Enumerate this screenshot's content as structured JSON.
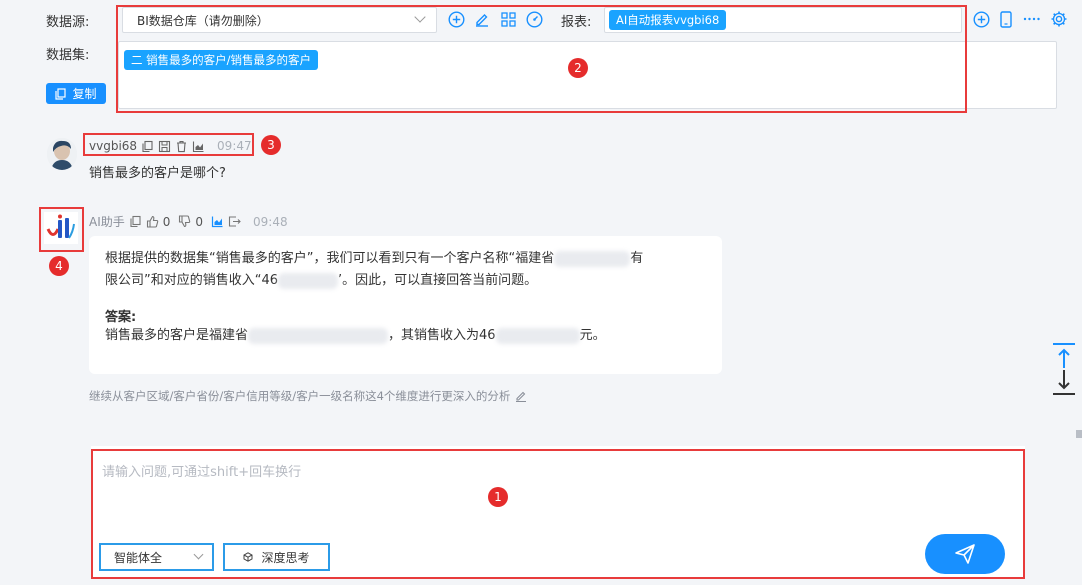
{
  "top": {
    "datasource_label": "数据源:",
    "datasource_value": "BI数据仓库（请勿删除）",
    "report_label": "报表:",
    "report_tag": "AI自动报表vvgbi68",
    "dataset_label": "数据集:",
    "dataset_tag": "二  销售最多的客户/销售最多的客户",
    "copy_label": "复制"
  },
  "user_msg": {
    "name": "vvgbi68",
    "time": "09:47",
    "text": "销售最多的客户是哪个?"
  },
  "ai_msg": {
    "name": "AI助手",
    "like_count": "0",
    "dislike_count": "0",
    "time": "09:48",
    "para1_a": "根据提供的数据集“销售最多的客户”，我们可以看到只有一个客户名称“福建省",
    "para1_b": "有",
    "para1_c": "限公司”和对应的销售收入“46",
    "para1_d": "’。因此，可以直接回答当前问题。",
    "answer_label": "答案:",
    "answer_a": "销售最多的客户是福建省",
    "answer_b": "，其销售收入为46",
    "answer_c": "元。"
  },
  "suggestion": "继续从客户区域/客户省份/客户信用等级/客户一级名称这4个维度进行更深入的分析",
  "input": {
    "placeholder": "请输入问题,可通过shift+回车换行",
    "agent_select": "智能体全",
    "deep_think": "深度思考"
  },
  "badges": [
    "1",
    "2",
    "3",
    "4"
  ],
  "colors": {
    "accent": "#1890ff",
    "annotation": "#e83b3b",
    "background": "#f3f5f8"
  }
}
